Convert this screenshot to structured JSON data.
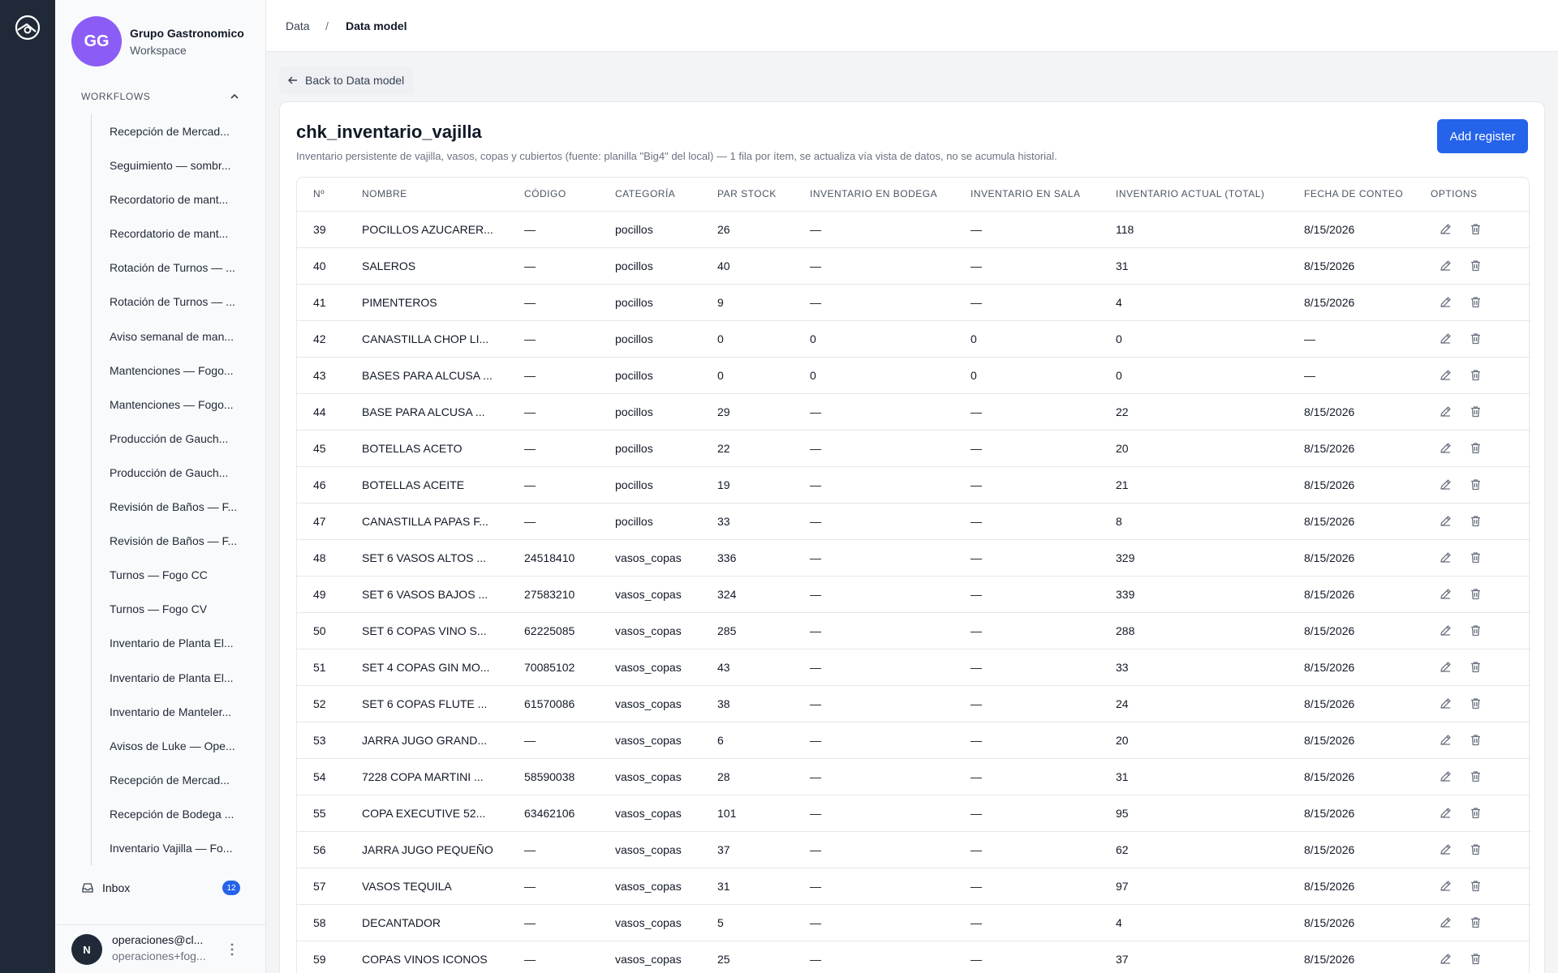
{
  "workspace": {
    "initials": "GG",
    "name": "Grupo Gastronomico",
    "subtitle": "Workspace"
  },
  "workflows": {
    "title": "WORKFLOWS",
    "items": [
      "Recepción de Mercad...",
      "Seguimiento — sombr...",
      "Recordatorio de mant...",
      "Recordatorio de mant...",
      "Rotación de Turnos — ...",
      "Rotación de Turnos — ...",
      "Aviso semanal de man...",
      "Mantenciones — Fogo...",
      "Mantenciones — Fogo...",
      "Producción de Gauch...",
      "Producción de Gauch...",
      "Revisión de Baños — F...",
      "Revisión de Baños — F...",
      "Turnos — Fogo CC",
      "Turnos — Fogo CV",
      "Inventario de Planta El...",
      "Inventario de Planta El...",
      "Inventario de Manteler...",
      "Avisos de Luke — Ope...",
      "Recepción de Mercad...",
      "Recepción de Bodega ...",
      "Inventario Vajilla — Fo..."
    ]
  },
  "inbox": {
    "label": "Inbox",
    "count": "12"
  },
  "user": {
    "initial": "N",
    "name": "operaciones@cl...",
    "email": "operaciones+fog..."
  },
  "breadcrumb": {
    "parent": "Data",
    "separator": "/",
    "current": "Data model"
  },
  "back_label": "Back to Data model",
  "table_info": {
    "title": "chk_inventario_vajilla",
    "description": "Inventario persistente de vajilla, vasos, copas y cubiertos (fuente: planilla \"Big4\" del local) — 1 fila por ítem, se actualiza vía vista de datos, no se acumula historial.",
    "add_label": "Add register"
  },
  "columns": [
    "Nº",
    "Nombre",
    "Código",
    "Categoría",
    "Par stock",
    "Inventario en bodega",
    "Inventario en sala",
    "Inventario actual (total)",
    "Fecha de conteo",
    "Options"
  ],
  "rows": [
    [
      "39",
      "POCILLOS AZUCARER...",
      "—",
      "pocillos",
      "26",
      "—",
      "—",
      "118",
      "8/15/2026"
    ],
    [
      "40",
      "SALEROS",
      "—",
      "pocillos",
      "40",
      "—",
      "—",
      "31",
      "8/15/2026"
    ],
    [
      "41",
      "PIMENTEROS",
      "—",
      "pocillos",
      "9",
      "—",
      "—",
      "4",
      "8/15/2026"
    ],
    [
      "42",
      "CANASTILLA CHOP LI...",
      "—",
      "pocillos",
      "0",
      "0",
      "0",
      "0",
      "—"
    ],
    [
      "43",
      "BASES PARA ALCUSA ...",
      "—",
      "pocillos",
      "0",
      "0",
      "0",
      "0",
      "—"
    ],
    [
      "44",
      "BASE PARA ALCUSA ...",
      "—",
      "pocillos",
      "29",
      "—",
      "—",
      "22",
      "8/15/2026"
    ],
    [
      "45",
      "BOTELLAS ACETO",
      "—",
      "pocillos",
      "22",
      "—",
      "—",
      "20",
      "8/15/2026"
    ],
    [
      "46",
      "BOTELLAS ACEITE",
      "—",
      "pocillos",
      "19",
      "—",
      "—",
      "21",
      "8/15/2026"
    ],
    [
      "47",
      "CANASTILLA PAPAS F...",
      "—",
      "pocillos",
      "33",
      "—",
      "—",
      "8",
      "8/15/2026"
    ],
    [
      "48",
      "SET 6 VASOS ALTOS ...",
      "24518410",
      "vasos_copas",
      "336",
      "—",
      "—",
      "329",
      "8/15/2026"
    ],
    [
      "49",
      "SET 6 VASOS BAJOS ...",
      "27583210",
      "vasos_copas",
      "324",
      "—",
      "—",
      "339",
      "8/15/2026"
    ],
    [
      "50",
      "SET 6 COPAS VINO S...",
      "62225085",
      "vasos_copas",
      "285",
      "—",
      "—",
      "288",
      "8/15/2026"
    ],
    [
      "51",
      "SET 4 COPAS GIN MO...",
      "70085102",
      "vasos_copas",
      "43",
      "—",
      "—",
      "33",
      "8/15/2026"
    ],
    [
      "52",
      "SET 6 COPAS FLUTE ...",
      "61570086",
      "vasos_copas",
      "38",
      "—",
      "—",
      "24",
      "8/15/2026"
    ],
    [
      "53",
      "JARRA JUGO GRAND...",
      "—",
      "vasos_copas",
      "6",
      "—",
      "—",
      "20",
      "8/15/2026"
    ],
    [
      "54",
      "7228 COPA MARTINI ...",
      "58590038",
      "vasos_copas",
      "28",
      "—",
      "—",
      "31",
      "8/15/2026"
    ],
    [
      "55",
      "COPA EXECUTIVE 52...",
      "63462106",
      "vasos_copas",
      "101",
      "—",
      "—",
      "95",
      "8/15/2026"
    ],
    [
      "56",
      "JARRA JUGO PEQUEÑO",
      "—",
      "vasos_copas",
      "37",
      "—",
      "—",
      "62",
      "8/15/2026"
    ],
    [
      "57",
      "VASOS TEQUILA",
      "—",
      "vasos_copas",
      "31",
      "—",
      "—",
      "97",
      "8/15/2026"
    ],
    [
      "58",
      "DECANTADOR",
      "—",
      "vasos_copas",
      "5",
      "—",
      "—",
      "4",
      "8/15/2026"
    ],
    [
      "59",
      "COPAS VINOS ICONOS",
      "—",
      "vasos_copas",
      "25",
      "—",
      "—",
      "37",
      "8/15/2026"
    ]
  ]
}
